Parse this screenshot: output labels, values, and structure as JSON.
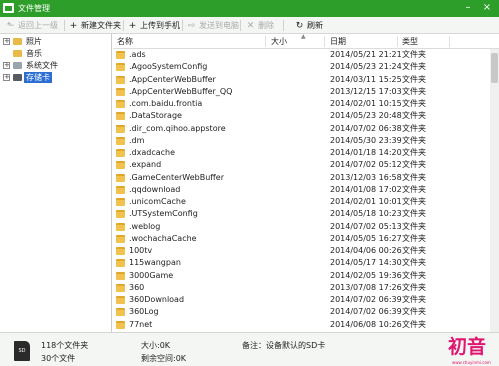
{
  "window": {
    "title": "文件管理",
    "accent": "#2e9e2a"
  },
  "toolbar": {
    "back_label": "返回上一级",
    "new_folder_label": "新建文件夹",
    "upload_label": "上传到手机",
    "send_to_pc_label": "发送到电脑",
    "delete_label": "删除",
    "refresh_label": "刷新"
  },
  "sidebar": {
    "items": [
      {
        "label": "照片",
        "icon": "photo-folder-icon"
      },
      {
        "label": "音乐",
        "icon": "music-folder-icon"
      },
      {
        "label": "系统文件",
        "icon": "system-folder-icon"
      },
      {
        "label": "存储卡",
        "icon": "sd-card-icon",
        "selected": true
      }
    ]
  },
  "list": {
    "columns": {
      "name": "名称",
      "size": "大小",
      "date": "日期",
      "type": "类型"
    },
    "rows": [
      {
        "name": ".ads",
        "date": "2014/05/21 21:21",
        "type": "文件夹"
      },
      {
        "name": ".AgooSystemConfig",
        "date": "2014/05/23 21:24",
        "type": "文件夹"
      },
      {
        "name": ".AppCenterWebBuffer",
        "date": "2014/03/11 15:25",
        "type": "文件夹"
      },
      {
        "name": ".AppCenterWebBuffer_QQ",
        "date": "2013/12/15 17:03",
        "type": "文件夹"
      },
      {
        "name": ".com.baidu.frontia",
        "date": "2014/02/01 10:15",
        "type": "文件夹"
      },
      {
        "name": ".DataStorage",
        "date": "2014/05/23 20:48",
        "type": "文件夹"
      },
      {
        "name": ".dir_com.qihoo.appstore",
        "date": "2014/07/02 06:38",
        "type": "文件夹"
      },
      {
        "name": ".dm",
        "date": "2014/05/30 23:39",
        "type": "文件夹"
      },
      {
        "name": ".dxadcache",
        "date": "2014/01/18 14:20",
        "type": "文件夹"
      },
      {
        "name": ".expand",
        "date": "2014/07/02 05:12",
        "type": "文件夹"
      },
      {
        "name": ".GameCenterWebBuffer",
        "date": "2013/12/03 16:58",
        "type": "文件夹"
      },
      {
        "name": ".qqdownload",
        "date": "2014/01/08 17:02",
        "type": "文件夹"
      },
      {
        "name": ".unicomCache",
        "date": "2014/02/01 10:01",
        "type": "文件夹"
      },
      {
        "name": ".UTSystemConfig",
        "date": "2014/05/18 10:23",
        "type": "文件夹"
      },
      {
        "name": ".weblog",
        "date": "2014/07/02 05:13",
        "type": "文件夹"
      },
      {
        "name": ".wochachaCache",
        "date": "2014/05/05 16:27",
        "type": "文件夹"
      },
      {
        "name": "100tv",
        "date": "2014/04/06 00:26",
        "type": "文件夹"
      },
      {
        "name": "115wangpan",
        "date": "2014/05/17 14:30",
        "type": "文件夹"
      },
      {
        "name": "3000Game",
        "date": "2014/02/05 19:36",
        "type": "文件夹"
      },
      {
        "name": "360",
        "date": "2013/07/08 17:26",
        "type": "文件夹"
      },
      {
        "name": "360Download",
        "date": "2014/07/02 06:39",
        "type": "文件夹"
      },
      {
        "name": "360Log",
        "date": "2014/07/02 06:39",
        "type": "文件夹"
      },
      {
        "name": "77net",
        "date": "2014/06/08 10:26",
        "type": "文件夹"
      }
    ]
  },
  "status": {
    "folder_count": "118个文件夹",
    "file_count": "30个文件",
    "size": "大小:0K",
    "free_space": "剩余空间:0K",
    "note": "备注：设备默认的SD卡",
    "device_icon": "sd-card-icon",
    "device_icon_text": "SD"
  },
  "logo": {
    "text": "初音",
    "subtext": "www.chuyinmi.com",
    "color": "#e0156f"
  }
}
